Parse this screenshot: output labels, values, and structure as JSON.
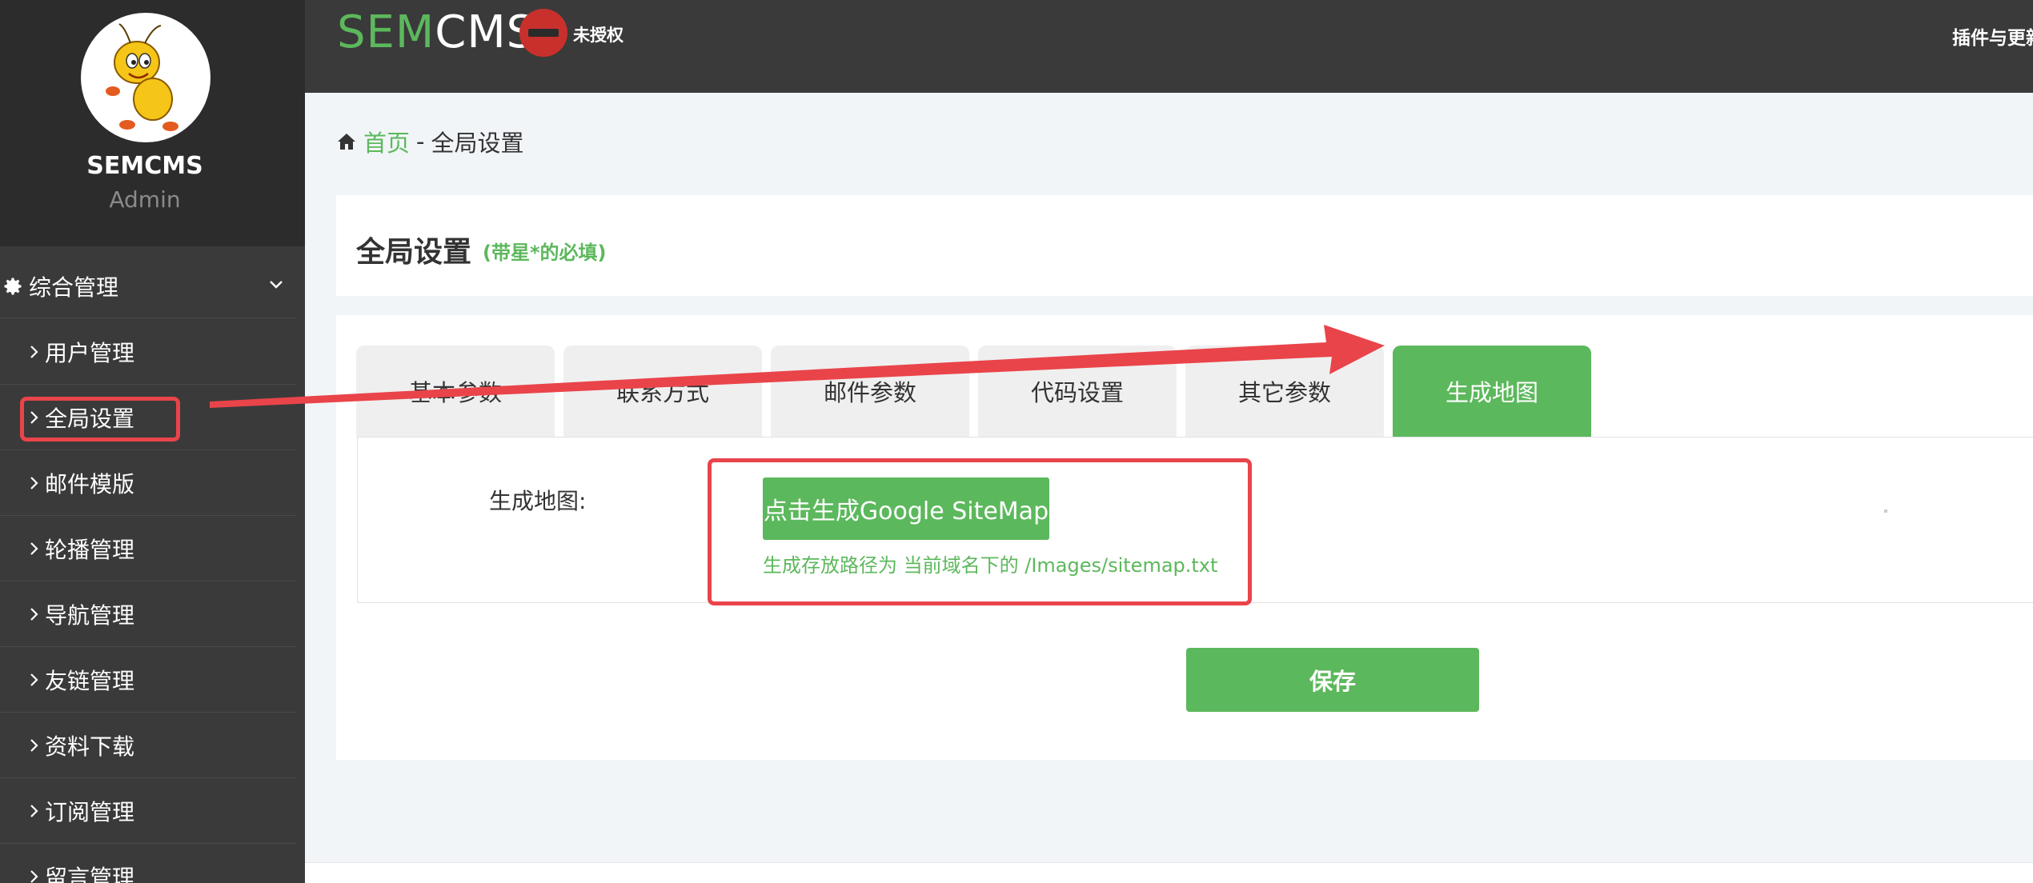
{
  "sidebar": {
    "brand_name": "SEMCMS",
    "role": "Admin",
    "section_title": "综合管理",
    "items": [
      {
        "label": "用户管理"
      },
      {
        "label": "全局设置"
      },
      {
        "label": "邮件模版"
      },
      {
        "label": "轮播管理"
      },
      {
        "label": "导航管理"
      },
      {
        "label": "友链管理"
      },
      {
        "label": "资料下载"
      },
      {
        "label": "订阅管理"
      },
      {
        "label": "留言管理"
      }
    ]
  },
  "header": {
    "logo_sem": "SEM",
    "logo_cms": "CMS",
    "unauthorized_label": "未授权",
    "plugin_link": "插件与更新"
  },
  "breadcrumb": {
    "home": "首页",
    "separator": "-",
    "current": "全局设置"
  },
  "page": {
    "title": "全局设置",
    "hint": "(带星*的必填)"
  },
  "tabs": [
    {
      "label": "基本参数"
    },
    {
      "label": "联系方式"
    },
    {
      "label": "邮件参数"
    },
    {
      "label": "代码设置"
    },
    {
      "label": "其它参数"
    },
    {
      "label": "生成地图",
      "active": true
    }
  ],
  "sitemap": {
    "field_label": "生成地图:",
    "button_label": "点击生成Google SiteMap",
    "note": "生成存放路径为 当前域名下的 /Images/sitemap.txt"
  },
  "actions": {
    "save_label": "保存"
  },
  "colors": {
    "accent": "#5cb85c",
    "sidebar_bg": "#3a3a3a",
    "annotation": "#e9444a"
  }
}
